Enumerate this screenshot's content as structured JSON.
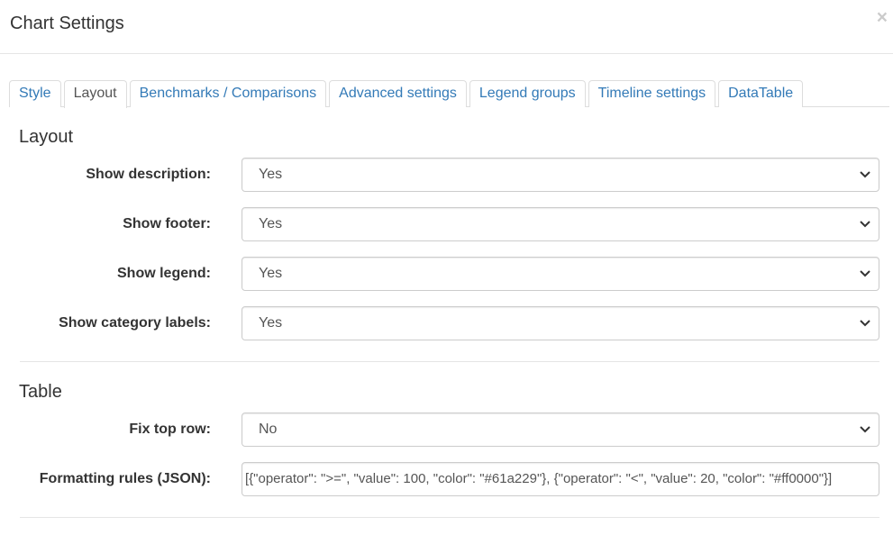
{
  "modal": {
    "title": "Chart Settings",
    "close_symbol": "×"
  },
  "tabs": [
    {
      "label": "Style",
      "active": false
    },
    {
      "label": "Layout",
      "active": true
    },
    {
      "label": "Benchmarks / Comparisons",
      "active": false
    },
    {
      "label": "Advanced settings",
      "active": false
    },
    {
      "label": "Legend groups",
      "active": false
    },
    {
      "label": "Timeline settings",
      "active": false
    },
    {
      "label": "DataTable",
      "active": false
    }
  ],
  "layout_section": {
    "title": "Layout",
    "fields": [
      {
        "label": "Show description:",
        "value": "Yes"
      },
      {
        "label": "Show footer:",
        "value": "Yes"
      },
      {
        "label": "Show legend:",
        "value": "Yes"
      },
      {
        "label": "Show category labels:",
        "value": "Yes"
      }
    ]
  },
  "table_section": {
    "title": "Table",
    "fix_top_row": {
      "label": "Fix top row:",
      "value": "No"
    },
    "formatting_rules": {
      "label": "Formatting rules (JSON):",
      "value": "[{\"operator\": \">=\", \"value\": 100, \"color\": \"#61a229\"}, {\"operator\": \"<\", \"value\": 20, \"color\": \"#ff0000\"}]"
    }
  },
  "colors": {
    "link": "#337ab7",
    "border": "#cccccc"
  },
  "icons": {
    "close": "close-icon",
    "dropdown": "chevron-down-icon"
  }
}
